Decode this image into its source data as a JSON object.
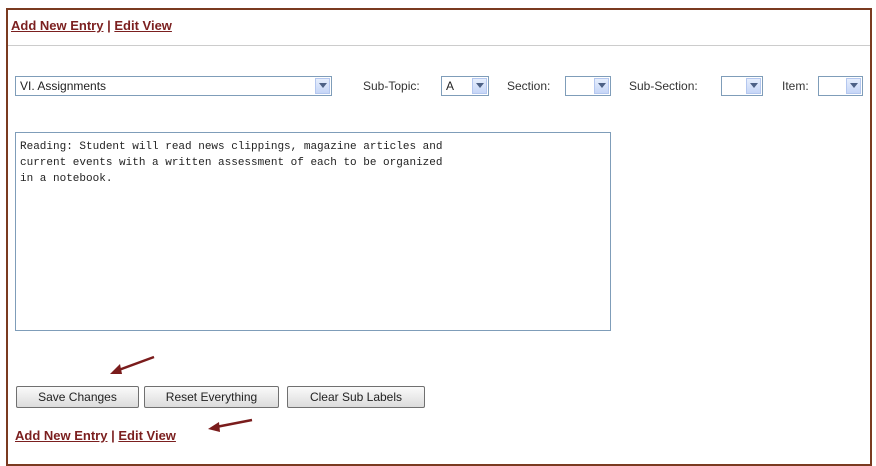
{
  "top_links": {
    "add_new_entry": "Add New Entry",
    "separator": "|",
    "edit_view": "Edit View"
  },
  "topic_select": {
    "value": "VI. Assignments"
  },
  "sub_topic": {
    "label": "Sub-Topic:",
    "value": "A"
  },
  "section": {
    "label": "Section:",
    "value": ""
  },
  "sub_section": {
    "label": "Sub-Section:",
    "value": ""
  },
  "item": {
    "label": "Item:",
    "value": ""
  },
  "entry_text": "Reading: Student will read news clippings, magazine articles and\ncurrent events with a written assessment of each to be organized\nin a notebook.",
  "buttons": {
    "save": "Save Changes",
    "reset": "Reset Everything",
    "clear": "Clear Sub Labels"
  },
  "bottom_links": {
    "add_new_entry": "Add New Entry",
    "separator": "|",
    "edit_view": "Edit View"
  },
  "colors": {
    "link": "#7b1f1f",
    "frame_border": "#7a3a20",
    "annotation_arrow": "#7a1c1c"
  },
  "icons": {
    "dropdown": "chevron-down-icon",
    "annotation": "arrow-icon"
  }
}
